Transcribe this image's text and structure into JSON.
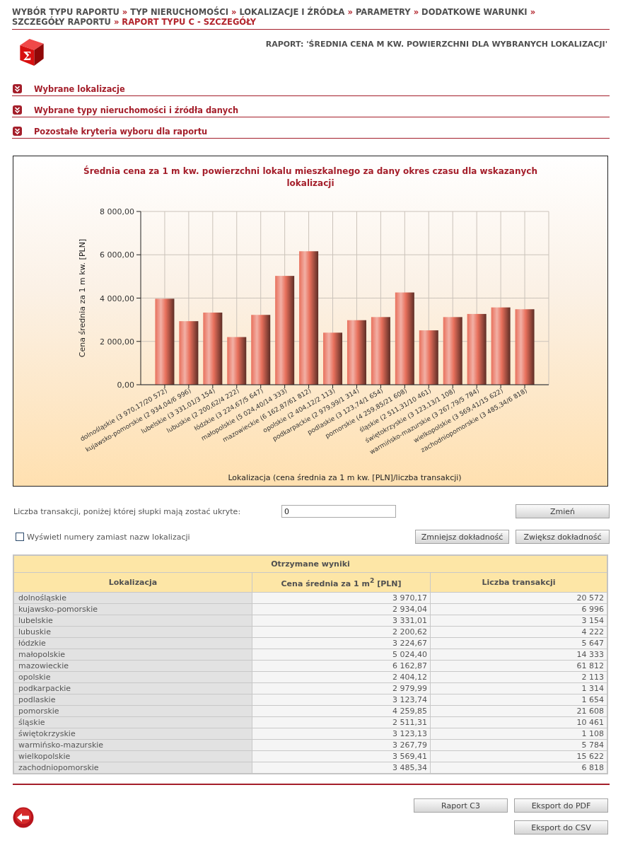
{
  "breadcrumb": [
    {
      "label": "WYBÓR TYPU RAPORTU",
      "current": false
    },
    {
      "separator": "»",
      "label": "TYP NIERUCHOMOŚCI",
      "current": false
    },
    {
      "separator": "»",
      "label": "LOKALIZACJE I ŹRÓDŁA",
      "current": false
    },
    {
      "separator": "»",
      "label": "PARAMETRY",
      "current": false
    },
    {
      "separator": "»",
      "label": "DODATKOWE WARUNKI",
      "current": false
    },
    {
      "separator": "»",
      "label": "SZCZEGÓŁY RAPORTU",
      "current": false
    },
    {
      "separator": "»",
      "label": "RAPORT TYPU C - SZCZEGÓŁY",
      "current": true
    }
  ],
  "logo_symbol": "Σ",
  "report_title": "RAPORT: 'ŚREDNIA CENA M KW. POWIERZCHNI DLA WYBRANYCH LOKALIZACJI'",
  "sections": [
    {
      "label": "Wybrane lokalizacje",
      "expanded": false
    },
    {
      "label": "Wybrane typy nieruchomości i źródła danych",
      "expanded": false
    },
    {
      "label": "Pozostałe kryteria wyboru dla raportu",
      "expanded": false
    }
  ],
  "chart": {
    "chart_data": {
      "type": "bar",
      "title": "Średnia cena za 1 m kw. powierzchni lokalu mieszkalnego za dany okres czasu dla wskazanych lokalizacji",
      "xlabel": "Lokalizacja (cena średnia za 1 m kw. [PLN]/liczba transakcji)",
      "ylabel": "Cena średnia za 1 m kw. [PLN]",
      "categories": [
        "dolnośląskie (3 970,17/20 572)",
        "kujawsko-pomorskie (2 934,04/6 996)",
        "lubelskie (3 331,01/3 154)",
        "lubuskie (2 200,62/4 222)",
        "łódzkie (3 224,67/5 647)",
        "małopolskie (5 024,40/14 333)",
        "mazowieckie (6 162,87/61 812)",
        "opolskie (2 404,12/2 113)",
        "podkarpackie (2 979,99/1 314)",
        "podlaskie (3 123,74/1 654)",
        "pomorskie (4 259,85/21 608)",
        "śląskie (2 511,31/10 461)",
        "świętokrzyskie (3 123,13/1 108)",
        "warmińsko-mazurskie (3 267,79/5 784)",
        "wielkopolskie (3 569,41/15 622)",
        "zachodniopomorskie (3 485,34/6 818)"
      ],
      "series": [
        {
          "color": "#e8705c",
          "values": [
            3970.17,
            2934.04,
            3331.01,
            2200.62,
            3224.67,
            5024.4,
            6162.87,
            2404.12,
            2979.99,
            3123.74,
            4259.85,
            2511.31,
            3123.13,
            3267.79,
            3569.41,
            3485.34
          ]
        }
      ],
      "ylim": [
        0,
        8000
      ],
      "yticks": [
        {
          "value": 0,
          "label": "0,00"
        },
        {
          "value": 2000,
          "label": "2 000,00"
        },
        {
          "value": 4000,
          "label": "4 000,00"
        },
        {
          "value": 6000,
          "label": "6 000,00"
        },
        {
          "value": 8000,
          "label": "8 000,00"
        }
      ],
      "grid": true
    }
  },
  "threshold": {
    "label": "Liczba transakcji, poniżej której słupki mają zostać ukryte:",
    "value": "0",
    "button": "Zmień"
  },
  "display_option": {
    "label": "Wyświetl numery zamiast nazw lokalizacji",
    "checked": false
  },
  "precision_buttons": [
    "Zmniejsz dokładność",
    "Zwiększ dokładność"
  ],
  "results_table": {
    "title": "Otrzymane wyniki",
    "columns": [
      "Lokalizacja",
      "Cena średnia za 1 m$^{2}$ [PLN]",
      "Liczba transakcji"
    ],
    "rows": [
      [
        "dolnośląskie",
        "3 970,17",
        "20 572"
      ],
      [
        "kujawsko-pomorskie",
        "2 934,04",
        "6 996"
      ],
      [
        "lubelskie",
        "3 331,01",
        "3 154"
      ],
      [
        "lubuskie",
        "2 200,62",
        "4 222"
      ],
      [
        "łódzkie",
        "3 224,67",
        "5 647"
      ],
      [
        "małopolskie",
        "5 024,40",
        "14 333"
      ],
      [
        "mazowieckie",
        "6 162,87",
        "61 812"
      ],
      [
        "opolskie",
        "2 404,12",
        "2 113"
      ],
      [
        "podkarpackie",
        "2 979,99",
        "1 314"
      ],
      [
        "podlaskie",
        "3 123,74",
        "1 654"
      ],
      [
        "pomorskie",
        "4 259,85",
        "21 608"
      ],
      [
        "śląskie",
        "2 511,31",
        "10 461"
      ],
      [
        "świętokrzyskie",
        "3 123,13",
        "1 108"
      ],
      [
        "warmińsko-mazurskie",
        "3 267,79",
        "5 784"
      ],
      [
        "wielkopolskie",
        "3 569,41",
        "15 622"
      ],
      [
        "zachodniopomorskie",
        "3 485,34",
        "6 818"
      ]
    ]
  },
  "footer_buttons": [
    [
      "Raport C3",
      "Eksport do PDF"
    ],
    [
      "Eksport do CSV"
    ]
  ]
}
